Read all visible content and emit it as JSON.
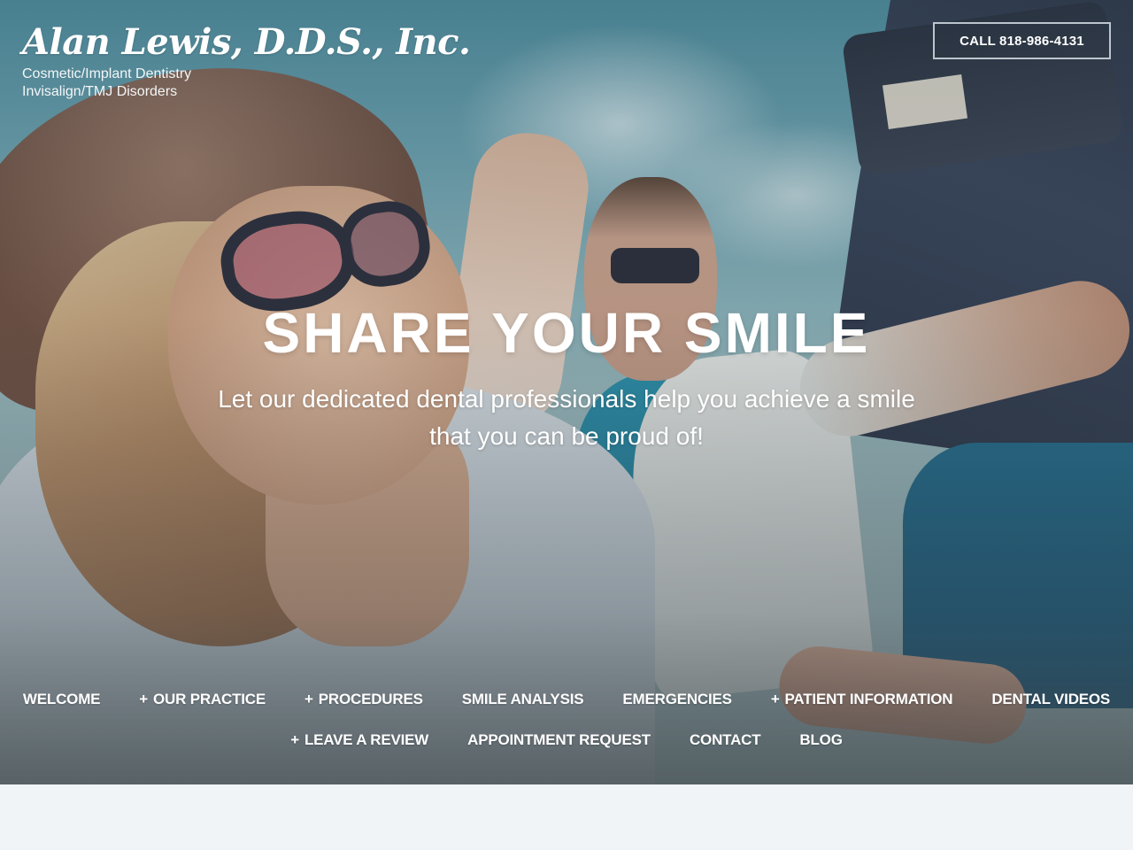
{
  "header": {
    "logo_title": "Alan Lewis, D.D.S., Inc.",
    "logo_sub_1": "Cosmetic/Implant Dentistry",
    "logo_sub_2": "Invisalign/TMJ Disorders",
    "call_button": "CALL 818-986-4131"
  },
  "hero": {
    "headline": "SHARE YOUR SMILE",
    "tagline": "Let our dedicated dental professionals help you achieve a smile that you can be proud of!"
  },
  "nav": {
    "row1": [
      {
        "label": "WELCOME",
        "has_submenu": false
      },
      {
        "label": "OUR PRACTICE",
        "has_submenu": true
      },
      {
        "label": "PROCEDURES",
        "has_submenu": true
      },
      {
        "label": "SMILE ANALYSIS",
        "has_submenu": false
      },
      {
        "label": "EMERGENCIES",
        "has_submenu": false
      },
      {
        "label": "PATIENT INFORMATION",
        "has_submenu": true
      },
      {
        "label": "DENTAL VIDEOS",
        "has_submenu": false
      }
    ],
    "row2": [
      {
        "label": "LEAVE A REVIEW",
        "has_submenu": true
      },
      {
        "label": "APPOINTMENT REQUEST",
        "has_submenu": false
      },
      {
        "label": "CONTACT",
        "has_submenu": false
      },
      {
        "label": "BLOG",
        "has_submenu": false
      }
    ],
    "submenu_glyph": "+"
  },
  "colors": {
    "text": "#ffffff",
    "page_background": "#f0f4f7",
    "sky": "#74a5b0"
  }
}
